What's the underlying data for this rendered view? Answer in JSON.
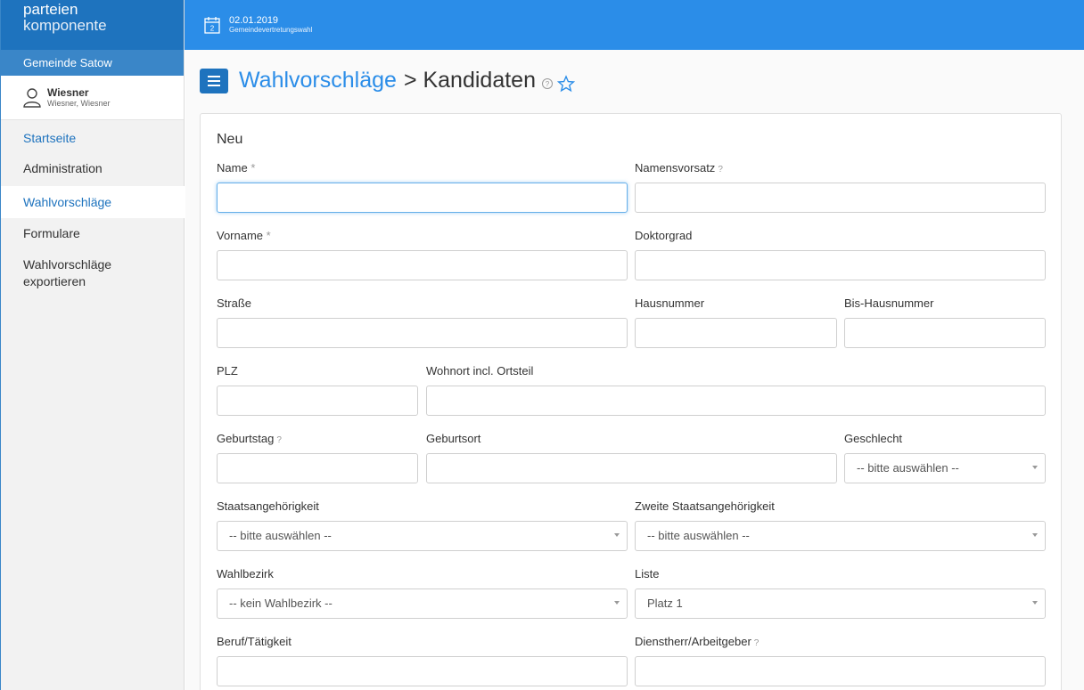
{
  "brand": {
    "line1": "parteien",
    "line2": "komponente"
  },
  "community": "Gemeinde Satow",
  "user": {
    "name": "Wiesner",
    "full": "Wiesner, Wiesner"
  },
  "nav": [
    {
      "label": "Startseite"
    },
    {
      "label": "Administration"
    },
    {
      "label": "Wahlvorschläge"
    },
    {
      "label": "Formulare"
    },
    {
      "label": "Wahlvorschläge exportieren"
    }
  ],
  "topbar": {
    "date": "02.01.2019",
    "subtitle": "Gemeindevertretungswahl",
    "calendar_day": "2"
  },
  "header": {
    "link": "Wahlvorschläge",
    "rest": "> Kandidaten",
    "help": "?"
  },
  "form": {
    "heading": "Neu",
    "labels": {
      "name": "Name",
      "namensvorsatz": "Namensvorsatz",
      "vorname": "Vorname",
      "doktorgrad": "Doktorgrad",
      "strasse": "Straße",
      "hausnummer": "Hausnummer",
      "bis_hausnummer": "Bis-Hausnummer",
      "plz": "PLZ",
      "wohnort": "Wohnort incl. Ortsteil",
      "geburtstag": "Geburtstag",
      "geburtsort": "Geburtsort",
      "geschlecht": "Geschlecht",
      "staatsangehoerigkeit": "Staatsangehörigkeit",
      "zweite_staatsangehoerigkeit": "Zweite Staatsangehörigkeit",
      "wahlbezirk": "Wahlbezirk",
      "liste": "Liste",
      "beruf": "Beruf/Tätigkeit",
      "dienstherr": "Dienstherr/Arbeitgeber"
    },
    "required_mark": "*",
    "help_mark": "?",
    "selects": {
      "geschlecht": "-- bitte auswählen --",
      "staatsangehoerigkeit": "-- bitte auswählen --",
      "zweite_staatsangehoerigkeit": "-- bitte auswählen --",
      "wahlbezirk": "-- kein Wahlbezirk --",
      "liste": "Platz 1"
    }
  },
  "colors": {
    "primary": "#1e73be",
    "topbar": "#2b8de8",
    "link": "#2b8de8"
  }
}
